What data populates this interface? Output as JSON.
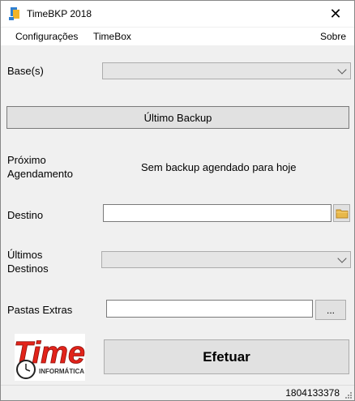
{
  "window": {
    "title": "TimeBKP 2018",
    "close_glyph": "✕"
  },
  "menu": {
    "items": [
      "Configurações",
      "TimeBox"
    ],
    "about": "Sobre"
  },
  "bases": {
    "label": "Base(s)",
    "selected": ""
  },
  "last_backup": {
    "label": "Último Backup"
  },
  "next_schedule": {
    "label_line1": "Próximo",
    "label_line2": "Agendamento",
    "value": "Sem backup agendado para hoje"
  },
  "destination": {
    "label": "Destino",
    "value": ""
  },
  "recent_destinations": {
    "label_line1": "Últimos",
    "label_line2": "Destinos",
    "selected": ""
  },
  "extra_folders": {
    "label": "Pastas Extras",
    "value": "",
    "browse_label": "..."
  },
  "logo": {
    "brand": "Time",
    "sub": "INFORMÁTICA"
  },
  "actions": {
    "execute_label": "Efetuar"
  },
  "status": {
    "text": "1804133378"
  },
  "colors": {
    "logo_red": "#e2231a",
    "folder_yellow": "#e8b84a"
  }
}
